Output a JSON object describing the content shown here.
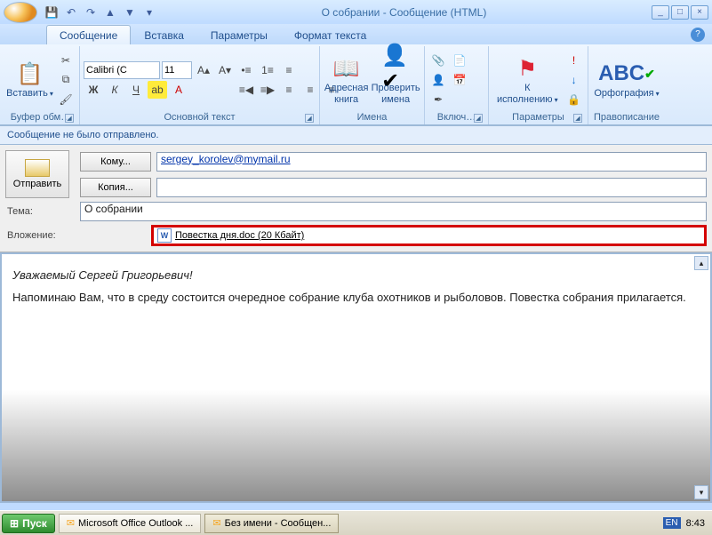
{
  "title": "О собрании - Сообщение (HTML)",
  "qat": {
    "save": "💾",
    "undo": "↶",
    "redo": "↷",
    "prev": "▲",
    "next": "▼"
  },
  "tabs": {
    "message": "Сообщение",
    "insert": "Вставка",
    "options": "Параметры",
    "format": "Формат текста"
  },
  "ribbon": {
    "clipboard": {
      "paste": "Вставить",
      "label": "Буфер обм…"
    },
    "font": {
      "name": "Calibri (С",
      "size": "11",
      "label": "Основной текст"
    },
    "names": {
      "addressbook": "Адресная\nкнига",
      "checknames": "Проверить\nимена",
      "label": "Имена"
    },
    "include": {
      "label": "Включ…"
    },
    "followup": {
      "btn": "К\nисполнению",
      "label": "Параметры"
    },
    "proof": {
      "btn": "Орфография",
      "label": "Правописание"
    }
  },
  "infobar": "Сообщение не было отправлено.",
  "header": {
    "send": "Отправить",
    "to_btn": "Кому...",
    "to_val": "sergey_korolev@mymail.ru",
    "cc_btn": "Копия...",
    "cc_val": "",
    "subject_lbl": "Тема:",
    "subject_val": "О собрании",
    "attach_lbl": "Вложение:",
    "attach_name": "Повестка дня.doc (20 Кбайт)"
  },
  "body": {
    "greeting": "Уважаемый Сергей Григорьевич!",
    "para": "Напоминаю  Вам, что в среду состоится очередное собрание клуба охотников и рыболовов. Повестка собрания прилагается."
  },
  "taskbar": {
    "start": "Пуск",
    "item1": "Microsoft Office Outlook ...",
    "item2": "Без имени - Сообщен...",
    "lang": "EN",
    "clock": "8:43"
  }
}
